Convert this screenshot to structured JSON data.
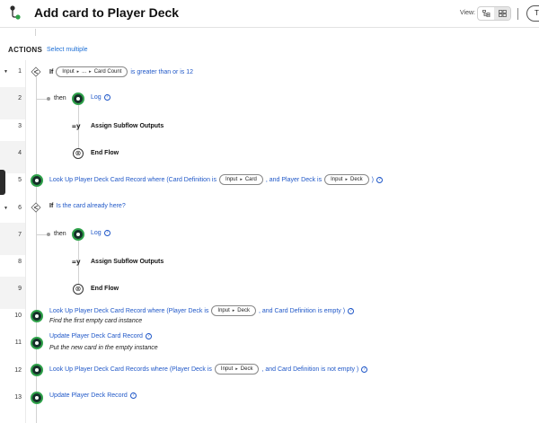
{
  "header": {
    "title": "Add card to Player Deck",
    "view_label": "View:",
    "right_button_label": "T",
    "icons": [
      "flow-icon",
      "tree-view-icon",
      "grid-view-icon"
    ]
  },
  "actions": {
    "heading": "ACTIONS",
    "select_multiple": "Select multiple"
  },
  "rows": {
    "r1": {
      "num": "1",
      "if": "If",
      "pill": [
        "Input",
        "...",
        "Card Count"
      ],
      "rest": "is greater than or is 12"
    },
    "r2": {
      "num": "2",
      "then": "then",
      "label": "Log"
    },
    "r3": {
      "num": "3",
      "label": "Assign Subflow Outputs",
      "icon_text": "=y"
    },
    "r4": {
      "num": "4",
      "label": "End Flow",
      "icon_text": "⊗"
    },
    "r5": {
      "num": "5",
      "pre": "Look Up Player Deck Card Record where (Card Definition is",
      "pill1": [
        "Input",
        "Card"
      ],
      "mid": ", and Player Deck is",
      "pill2": [
        "Input",
        "Deck"
      ],
      "post": ")"
    },
    "r6": {
      "num": "6",
      "if": "If",
      "text": "Is the card already here?"
    },
    "r7": {
      "num": "7",
      "then": "then",
      "label": "Log"
    },
    "r8": {
      "num": "8",
      "label": "Assign Subflow Outputs",
      "icon_text": "=y"
    },
    "r9": {
      "num": "9",
      "label": "End Flow",
      "icon_text": "⊗"
    },
    "r10": {
      "num": "10",
      "pre": "Look Up Player Deck Card Record where (Player Deck is",
      "pill": [
        "Input",
        "Deck"
      ],
      "post": ", and Card Definition is empty )",
      "note": "Find the first empty card instance"
    },
    "r11": {
      "num": "11",
      "label": "Update Player Deck Card Record",
      "note": "Put the new card in the empty instance"
    },
    "r12": {
      "num": "12",
      "pre": "Look Up Player Deck Card Records where (Player Deck is",
      "pill": [
        "Input",
        "Deck"
      ],
      "post": ", and Card Definition is not empty )"
    },
    "r13": {
      "num": "13",
      "label": "Update Player Deck Record"
    }
  },
  "colors": {
    "link": "#2058c8",
    "action_icon_ring": "#2fa24a",
    "action_icon_fill": "#16302a",
    "gutter_band": "#f3f3f3"
  }
}
